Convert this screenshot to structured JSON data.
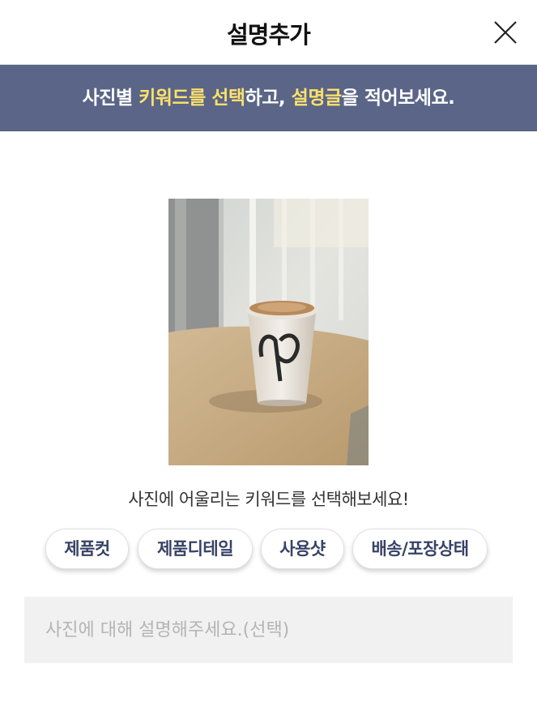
{
  "header": {
    "title": "설명추가",
    "close_icon": "close-icon"
  },
  "banner": {
    "part1": "사진별 ",
    "highlight1": "키워드를 선택",
    "part2": "하고, ",
    "highlight2": "설명글",
    "part3": "을 적어보세요.",
    "highlight_color": "#ffe16b",
    "background": "#5a6587"
  },
  "photo": {
    "subject": "paper coffee cup on a table"
  },
  "keywords": {
    "prompt": "사진에 어울리는 키워드를 선택해보세요!",
    "items": [
      "제품컷",
      "제품디테일",
      "사용샷",
      "배송/포장상태"
    ]
  },
  "description": {
    "placeholder": "사진에 대해 설명해주세요.(선택)",
    "value": ""
  }
}
